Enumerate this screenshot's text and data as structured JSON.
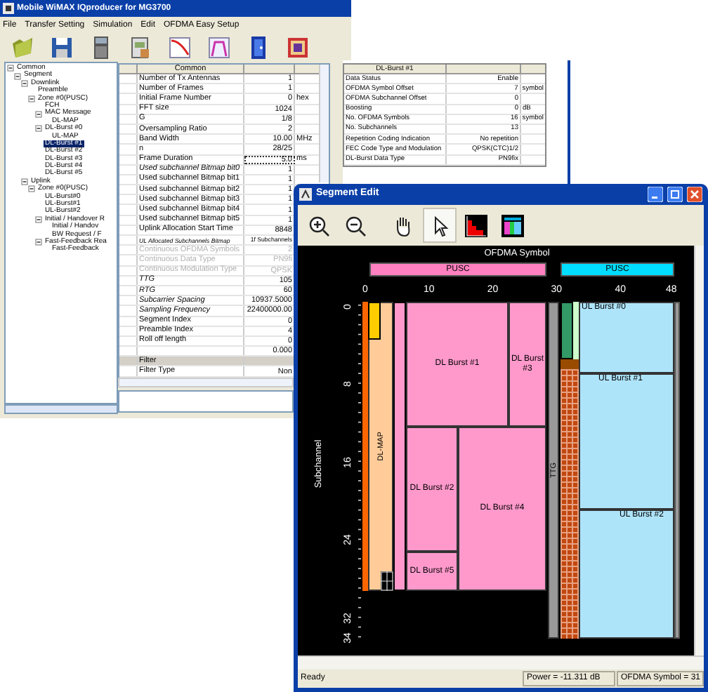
{
  "main_window": {
    "title": "Mobile WiMAX IQproducer for MG3700",
    "menu": [
      "File",
      "Transfer Setting",
      "Simulation",
      "Edit",
      "OFDMA Easy Setup"
    ],
    "tree": [
      {
        "label": "Common",
        "selected": false,
        "expanded": true,
        "children": [
          {
            "label": "Segment",
            "selected": false,
            "expanded": true,
            "children": [
              {
                "label": "Downlink",
                "selected": false,
                "expanded": true,
                "children": [
                  {
                    "label": "Preamble",
                    "selected": false
                  },
                  {
                    "label": "Zone #0(PUSC)",
                    "selected": false,
                    "expanded": true,
                    "children": [
                      {
                        "label": "FCH",
                        "selected": false
                      },
                      {
                        "label": "MAC Message",
                        "selected": false,
                        "expanded": true,
                        "children": [
                          {
                            "label": "DL-MAP",
                            "selected": false
                          }
                        ]
                      },
                      {
                        "label": "DL-Burst #0",
                        "selected": false,
                        "expanded": true,
                        "children": [
                          {
                            "label": "UL-MAP",
                            "selected": false
                          }
                        ]
                      },
                      {
                        "label": "DL-Burst #1",
                        "selected": true
                      },
                      {
                        "label": "DL-Burst #2",
                        "selected": false
                      },
                      {
                        "label": "DL-Burst #3",
                        "selected": false
                      },
                      {
                        "label": "DL-Burst #4",
                        "selected": false
                      },
                      {
                        "label": "DL-Burst #5",
                        "selected": false
                      }
                    ]
                  }
                ]
              },
              {
                "label": "Uplink",
                "selected": false,
                "expanded": true,
                "children": [
                  {
                    "label": "Zone #0(PUSC)",
                    "selected": false,
                    "expanded": true,
                    "children": [
                      {
                        "label": "UL-Burst#0",
                        "selected": false
                      },
                      {
                        "label": "UL-Burst#1",
                        "selected": false
                      },
                      {
                        "label": "UL-Burst#2",
                        "selected": false
                      },
                      {
                        "label": "Initial / Handover R",
                        "selected": false,
                        "expanded": true,
                        "children": [
                          {
                            "label": "Initial / Handov",
                            "selected": false
                          },
                          {
                            "label": "BW Request / F",
                            "selected": false
                          }
                        ]
                      },
                      {
                        "label": "Fast-Feedback Rea",
                        "selected": false,
                        "expanded": true,
                        "children": [
                          {
                            "label": "Fast-Feedback",
                            "selected": false
                          }
                        ]
                      }
                    ]
                  }
                ]
              }
            ]
          }
        ]
      }
    ],
    "common_table": {
      "header": "Common",
      "rows": [
        {
          "name": "Number of Tx Antennas",
          "value": "1",
          "kind": "normal",
          "focused": false
        },
        {
          "name": "Number of Frames",
          "value": "1",
          "kind": "normal",
          "focused": false
        },
        {
          "name": "Initial Frame Number",
          "value": "0",
          "unit": "hex",
          "kind": "normal",
          "focused": false
        },
        {
          "name": "FFT size",
          "value": "1024",
          "kind": "normal",
          "focused": false
        },
        {
          "name": "G",
          "value": "1/8",
          "kind": "normal",
          "focused": false
        },
        {
          "name": "Oversampling Ratio",
          "value": "2",
          "kind": "normal",
          "focused": false
        },
        {
          "name": "Band Width",
          "value": "10.00",
          "unit": "MHz",
          "kind": "normal",
          "focused": false
        },
        {
          "name": "n",
          "value": "28/25",
          "kind": "normal",
          "focused": false
        },
        {
          "name": "Frame Duration",
          "value": "5.0",
          "unit": "ms",
          "kind": "normal",
          "focused": true
        },
        {
          "name": "Used subchannel Bitmap bit0",
          "value": "1",
          "kind": "readonly",
          "focused": false
        },
        {
          "name": "Used subchannel Bitmap bit1",
          "value": "1",
          "kind": "normal",
          "focused": false
        },
        {
          "name": "Used subchannel Bitmap bit2",
          "value": "1",
          "kind": "normal",
          "focused": false
        },
        {
          "name": "Used subchannel Bitmap bit3",
          "value": "1",
          "kind": "normal",
          "focused": false
        },
        {
          "name": "Used subchannel Bitmap bit4",
          "value": "1",
          "kind": "normal",
          "focused": false
        },
        {
          "name": "Used subchannel Bitmap bit5",
          "value": "1",
          "kind": "normal",
          "focused": false
        },
        {
          "name": "Uplink Allocation Start Time",
          "value": "8848",
          "kind": "normal",
          "focused": false
        },
        {
          "name": "UL Allocated Subchannels Bitmap",
          "value": "1f Subchannels",
          "kind": "readonly",
          "focused": false
        },
        {
          "name": "Continuous OFDMA Symbols",
          "value": "2",
          "kind": "disabled",
          "focused": false
        },
        {
          "name": "Continuous Data Type",
          "value": "PN9fi",
          "kind": "disabled",
          "focused": false
        },
        {
          "name": "Continuous Modulation Type",
          "value": "QPSK",
          "kind": "disabled",
          "focused": false
        },
        {
          "name": "TTG",
          "value": "105",
          "kind": "readonly",
          "focused": false
        },
        {
          "name": "RTG",
          "value": "60",
          "kind": "readonly",
          "focused": false
        },
        {
          "name": "Subcarrier Spacing",
          "value": "10937.5000",
          "kind": "readonly",
          "focused": false
        },
        {
          "name": "Sampling Frequency",
          "value": "22400000.00",
          "kind": "readonly",
          "focused": false
        },
        {
          "name": "Segment Index",
          "value": "0",
          "kind": "normal",
          "focused": false
        },
        {
          "name": "Preamble Index",
          "value": "4",
          "kind": "normal",
          "focused": false
        },
        {
          "name": "Roll off length",
          "value": "0",
          "kind": "normal",
          "focused": false
        },
        {
          "value": "0.000",
          "kind": "normal",
          "focused": false
        },
        {
          "name": "Filter",
          "kind": "section",
          "focused": false
        },
        {
          "name": "Filter Type",
          "value": "Non",
          "kind": "normal",
          "focused": false
        }
      ]
    },
    "burst_table": {
      "header": "DL-Burst #1",
      "rows": [
        {
          "name": "Data Status",
          "value": "Enable"
        },
        {
          "name": "OFDMA Symbol Offset",
          "value": "7",
          "unit": "symbol"
        },
        {
          "name": "OFDMA Subchannel Offset",
          "value": "0"
        },
        {
          "name": "Boosting",
          "value": "0",
          "unit": "dB"
        },
        {
          "name": "No. OFDMA Symbols",
          "value": "16",
          "unit": "symbol"
        },
        {
          "name": "No. Subchannels",
          "value": "13"
        },
        {
          "name": "Repetition Coding Indication",
          "value": "No repetition"
        },
        {
          "name": "FEC Code Type and Modulation",
          "value": "QPSK(CTC)1/2"
        },
        {
          "name": "DL-Burst Data Type",
          "value": "PN9fix"
        }
      ]
    }
  },
  "segment_window": {
    "title": "Segment Edit",
    "tools": [
      {
        "selected": false
      },
      {
        "selected": false
      },
      {
        "selected": false
      },
      {
        "selected": true
      },
      {
        "selected": false
      },
      {
        "selected": false
      }
    ],
    "map": {
      "xlabel": "OFDMA Symbol",
      "ylabel": "Subchannel",
      "zones": [
        {
          "label": "PUSC",
          "color": "#ff80c0"
        },
        {
          "label": "PUSC",
          "color": "#00ddff"
        }
      ],
      "xticks": [
        "0",
        "10",
        "20",
        "30",
        "40",
        "48"
      ],
      "yticks": [
        "0",
        "8",
        "16",
        "24",
        "32",
        "34"
      ],
      "blocks": [
        {
          "label": "DL-MAP",
          "kind": "vertical",
          "color": "#ffcc99"
        },
        {
          "label": "DL Burst #1",
          "kind": "centered",
          "color": "#ff99cc"
        },
        {
          "label": "DL Burst #3",
          "kind": "centered",
          "color": "#ff99cc"
        },
        {
          "label": "DL Burst #2",
          "kind": "centered",
          "color": "#ff99cc"
        },
        {
          "label": "DL Burst #4",
          "kind": "centered",
          "color": "#ff99cc"
        },
        {
          "label": "DL Burst #5",
          "kind": "centered",
          "color": "#ff99cc"
        },
        {
          "label": "TTG",
          "kind": "vertical",
          "color": "#999999"
        },
        {
          "label": "UL Burst #0",
          "kind": "corner",
          "color": "#aee4fa"
        },
        {
          "label": "UL Burst #1",
          "kind": "corner",
          "color": "#aee4fa"
        },
        {
          "label": "UL Burst #2",
          "kind": "corner",
          "color": "#aee4fa"
        }
      ]
    },
    "status": {
      "message": "Ready",
      "power": "Power = -11.311 dB",
      "symbol": "OFDMA Symbol = 31"
    }
  }
}
